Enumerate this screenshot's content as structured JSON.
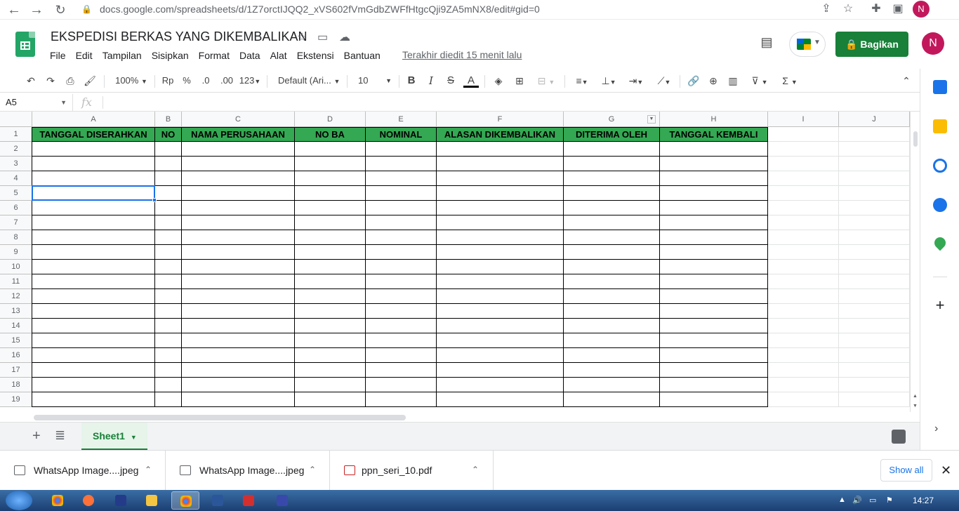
{
  "browser": {
    "url": "docs.google.com/spreadsheets/d/1Z7orctIJQQ2_xVS602fVmGdbZWFfHtgcQji9ZA5mNX8/edit#gid=0",
    "profile_initial": "N"
  },
  "doc": {
    "title": "EKSPEDISI BERKAS YANG DIKEMBALIKAN",
    "last_edit": "Terakhir diedit 15 menit lalu",
    "share_label": "Bagikan",
    "avatar_initial": "N"
  },
  "menu": [
    "File",
    "Edit",
    "Tampilan",
    "Sisipkan",
    "Format",
    "Data",
    "Alat",
    "Ekstensi",
    "Bantuan"
  ],
  "toolbar": {
    "zoom": "100%",
    "currency": "Rp",
    "percent": "%",
    "dec_less": ".0",
    "dec_more": ".00",
    "more_formats": "123",
    "font": "Default (Ari...",
    "font_size": "10",
    "bold": "B",
    "italic": "I",
    "strike": "S",
    "text_color": "A"
  },
  "formula_bar": {
    "name_box": "A5",
    "fx": "fx",
    "value": ""
  },
  "grid": {
    "columns": [
      "A",
      "B",
      "C",
      "D",
      "E",
      "F",
      "G",
      "H",
      "I",
      "J"
    ],
    "rows": [
      "1",
      "2",
      "3",
      "4",
      "5",
      "6",
      "7",
      "8",
      "9",
      "10",
      "11",
      "12",
      "13",
      "14",
      "15",
      "16",
      "17",
      "18",
      "19"
    ],
    "headers": [
      "TANGGAL DISERAHKAN",
      "NO",
      "NAMA PERUSAHAAN",
      "NO BA",
      "NOMINAL",
      "ALASAN DIKEMBALIKAN",
      "DITERIMA OLEH",
      "TANGGAL KEMBALI"
    ],
    "header_color": "#34a853",
    "selected_cell": "A5"
  },
  "sheets": {
    "active": "Sheet1"
  },
  "downloads": {
    "items": [
      {
        "name": "WhatsApp Image....jpeg"
      },
      {
        "name": "WhatsApp Image....jpeg"
      },
      {
        "name": "ppn_seri_10.pdf"
      }
    ],
    "show_all": "Show all"
  },
  "taskbar": {
    "clock": "14:27"
  },
  "colors": {
    "accent": "#1a73e8",
    "share": "#188038"
  }
}
